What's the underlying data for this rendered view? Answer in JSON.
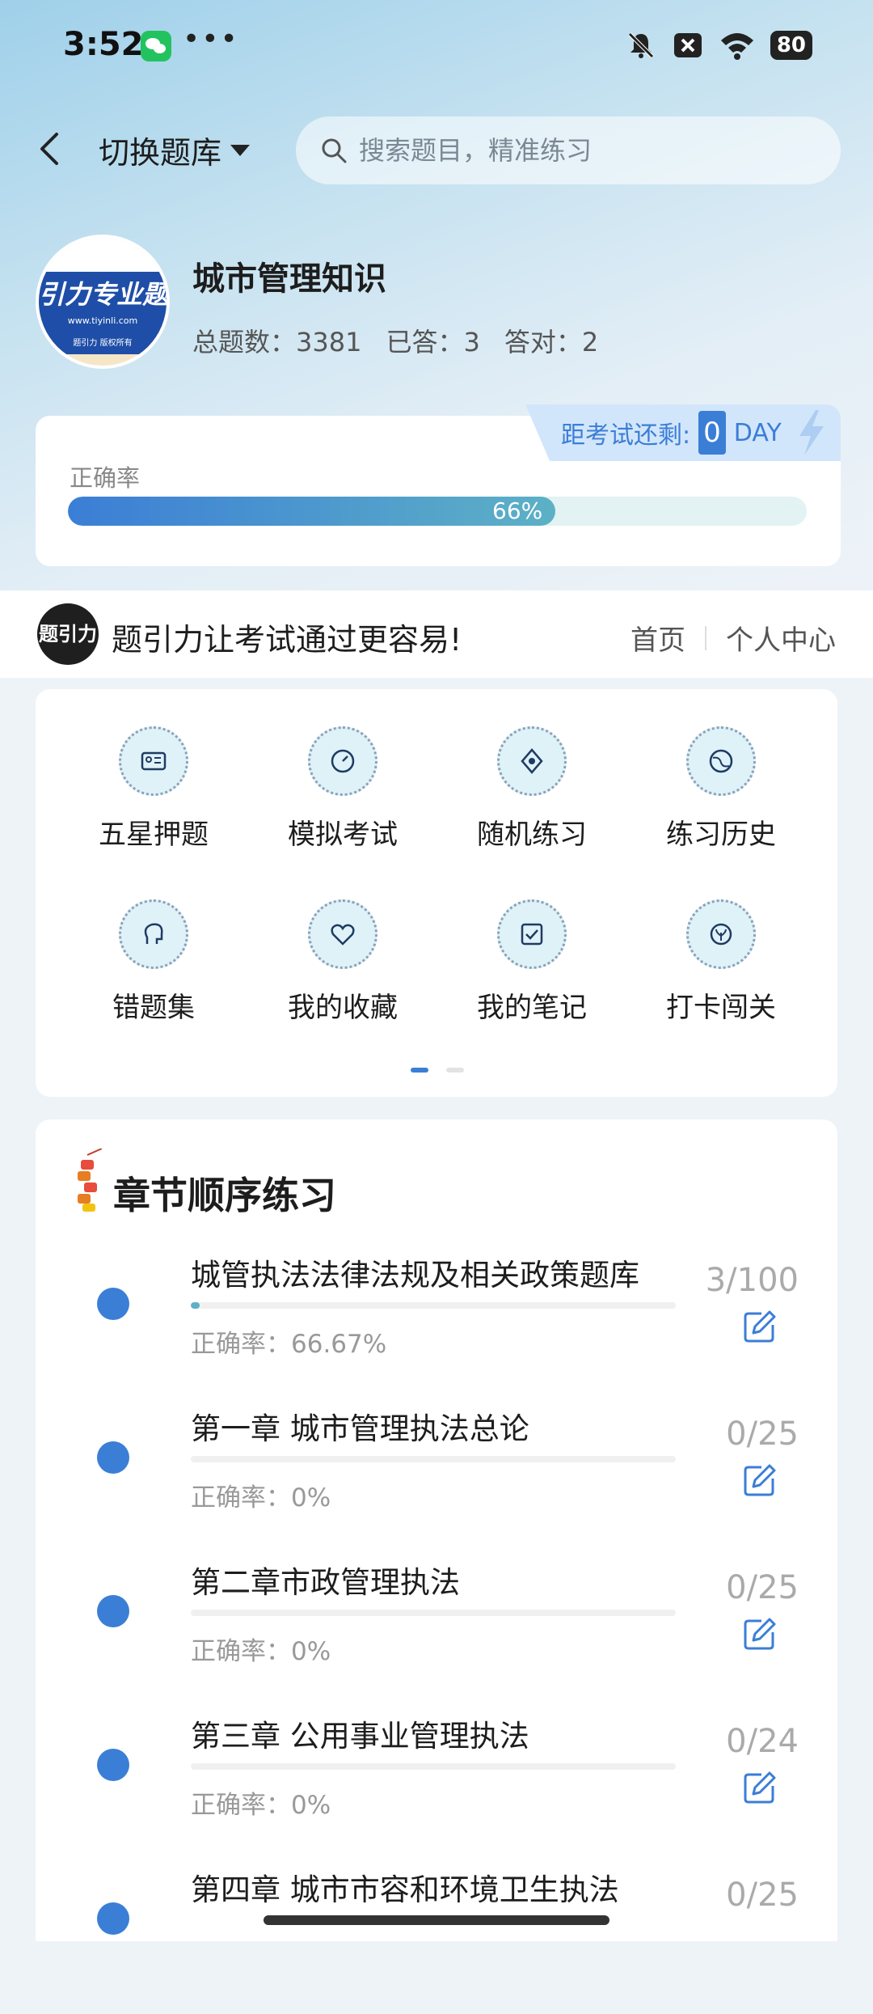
{
  "status": {
    "time": "3:52",
    "dots": "•••",
    "battery": "80"
  },
  "header": {
    "switch_label": "切换题库",
    "search_placeholder": "搜索题目，精准练习"
  },
  "subject": {
    "logo_text": "引力专业题",
    "logo_url": "www.tiyinli.com",
    "logo_footer": "题引力 版权所有",
    "title": "城市管理知识",
    "total_label": "总题数：3381",
    "answered_label": "已答：3",
    "correct_label": "答对：2"
  },
  "accuracy": {
    "label": "正确率",
    "percent_text": "66%",
    "percent": 0.66,
    "countdown_label": "距考试还剩:",
    "countdown_days": "0",
    "countdown_unit": "DAY"
  },
  "banner": {
    "logo_text": "题引力",
    "slogan": "题引力让考试通过更容易!",
    "nav_home": "首页",
    "nav_profile": "个人中心"
  },
  "features": [
    {
      "label": "五星押题",
      "icon": "id-card-icon"
    },
    {
      "label": "模拟考试",
      "icon": "gauge-icon"
    },
    {
      "label": "随机练习",
      "icon": "network-icon"
    },
    {
      "label": "练习历史",
      "icon": "globe-icon"
    },
    {
      "label": "错题集",
      "icon": "head-icon"
    },
    {
      "label": "我的收藏",
      "icon": "heart-icon"
    },
    {
      "label": "我的笔记",
      "icon": "note-check-icon"
    },
    {
      "label": "打卡闯关",
      "icon": "leaf-icon"
    }
  ],
  "chapters_title": "章节顺序练习",
  "chapters": [
    {
      "name": "城管执法法律法规及相关政策题库",
      "accuracy": "正确率：66.67%",
      "count": "3/100",
      "progress": 0.03
    },
    {
      "name": "第一章 城市管理执法总论",
      "accuracy": "正确率：0%",
      "count": "0/25",
      "progress": 0
    },
    {
      "name": "第二章市政管理执法",
      "accuracy": "正确率：0%",
      "count": "0/25",
      "progress": 0
    },
    {
      "name": "第三章 公用事业管理执法",
      "accuracy": "正确率：0%",
      "count": "0/24",
      "progress": 0
    },
    {
      "name": "第四章 城市市容和环境卫生执法",
      "accuracy": "",
      "count": "0/25",
      "progress": 0
    }
  ],
  "colors": {
    "accent": "#3b7ed6",
    "teal": "#5db1c6"
  }
}
